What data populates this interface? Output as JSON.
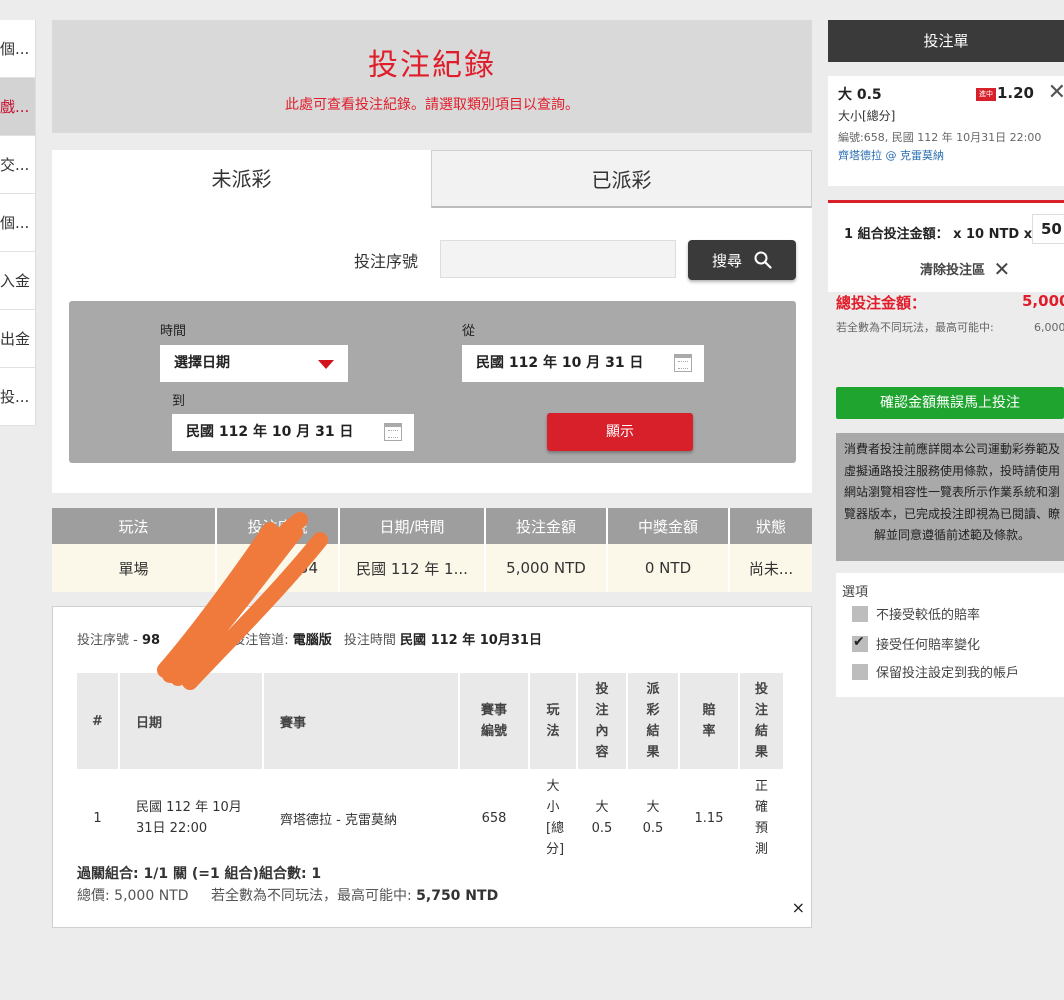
{
  "sidebar": {
    "items": [
      "個...",
      "戲...",
      "交...",
      "個...",
      "入金",
      "出金",
      "投..."
    ]
  },
  "header": {
    "title": "投注紀錄",
    "subtitle": "此處可查看投注紀錄。請選取類別項目以查詢。"
  },
  "tabs": {
    "unsettled": "未派彩",
    "settled": "已派彩"
  },
  "search": {
    "label": "投注序號",
    "value": "",
    "button": "搜尋"
  },
  "filter": {
    "time_label": "時間",
    "select_value": "選擇日期",
    "from_label": "從",
    "from_date": "民國 112 年 10 月 31 日",
    "to_label": "到",
    "to_date": "民國 112 年 10 月 31 日",
    "show_button": "顯示"
  },
  "results": {
    "headers": [
      "玩法",
      "投注序號",
      "日期/時間",
      "投注金額",
      "中獎金額",
      "狀態"
    ],
    "row": [
      "單場",
      "...54",
      "民國 112 年 1...",
      "5,000 NTD",
      "0 NTD",
      "尚未..."
    ]
  },
  "detail": {
    "serial_label": "投注序號 -",
    "serial_value": "98",
    "channel_label": "投注管道:",
    "channel_value": "電腦版",
    "time_label": "投注時間",
    "time_value": "民國 112 年 10月31日",
    "headers": [
      "#",
      "日期",
      "賽事",
      "賽事編號",
      "玩法",
      "投注內容",
      "派彩結果",
      "賠率",
      "投注結果"
    ],
    "row": {
      "no": "1",
      "date": "民國 112 年 10月 31日 22:00",
      "event": "齊塔德拉 - 克雷莫納",
      "event_no": "658",
      "play": "大小[總分]",
      "bet": "大 0.5",
      "payout": "大 0.5",
      "odds": "1.15",
      "result": "正確預測"
    },
    "summary1": "過關組合: 1/1 關 (=1 組合)組合數: 1",
    "total_label": "總價:",
    "total_value": "5,000 NTD",
    "max_label": "若全數為不同玩法，最高可能中:",
    "max_value": "5,750 NTD",
    "close": "×"
  },
  "slip": {
    "title": "投注單",
    "selection": "大 0.5",
    "flag": "進中",
    "odds": "1.20",
    "market": "大小[總分]",
    "info": "編號:658, 民國 112 年 10月31日 22:00",
    "match": "齊塔德拉 @ 克雷莫納",
    "combo_text": "1 組合投注金額： x 10 NTD x",
    "combo_amount": "50",
    "clear": "清除投注區",
    "total_label": "總投注金額：",
    "total_value": "5,000",
    "note": "若全數為不同玩法，最高可能中:",
    "note_value": "6,000",
    "confirm": "確認金額無誤馬上投注",
    "terms": "消費者投注前應詳閱本公司運動彩券範及虛擬通路投注服務使用條款，投時請使用網站瀏覽相容性一覽表所示作業系統和瀏覽器版本，已完成投注即視為已閱讀、瞭解並同意遵循前述範及條款。",
    "options_label": "選項",
    "options": [
      {
        "label": "不接受較低的賠率",
        "checked": false
      },
      {
        "label": "接受任何賠率變化",
        "checked": true
      },
      {
        "label": "保留投注設定到我的帳戶",
        "checked": false
      }
    ]
  },
  "colors": {
    "accent": "#e01e2b",
    "dark": "#3a3a3a",
    "green": "#1fa52f",
    "scribble": "#f07a3c"
  }
}
